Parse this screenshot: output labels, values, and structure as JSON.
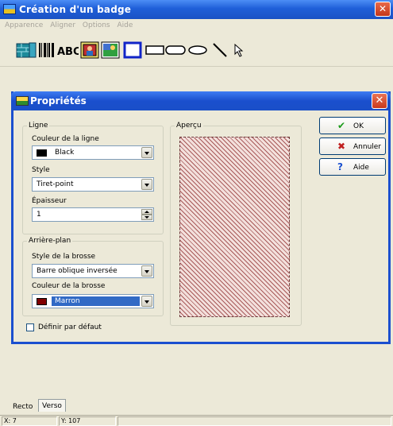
{
  "app": {
    "title": "Création d'un badge"
  },
  "menu": [
    "Apparence",
    "Aligner",
    "Options",
    "Aide"
  ],
  "toolbar_icons": [
    "wall-icon",
    "barcode-icon",
    "text-abc-icon",
    "image-icon",
    "photo-icon",
    "rectangle-icon",
    "rounded-rectangle-icon",
    "oval-rounded-icon",
    "ellipse-icon",
    "line-icon",
    "pointer-icon"
  ],
  "toolbar_labels": {
    "barcode": "ABC"
  },
  "dialog": {
    "title": "Propriétés",
    "ligne": {
      "legend": "Ligne",
      "couleur_label": "Couleur de la ligne",
      "couleur_value": "Black",
      "couleur_swatch": "#000000",
      "style_label": "Style",
      "style_value": "Tiret-point",
      "epaisseur_label": "Épaisseur",
      "epaisseur_value": "1"
    },
    "arriere_plan": {
      "legend": "Arrière-plan",
      "style_label": "Style de la brosse",
      "style_value": "Barre oblique inversée",
      "couleur_label": "Couleur de la brosse",
      "couleur_value": "Marron",
      "couleur_swatch": "#800000"
    },
    "apercu": {
      "legend": "Aperçu"
    },
    "checkbox_label": "Définir par défaut",
    "buttons": {
      "ok": "OK",
      "annuler": "Annuler",
      "aide": "Aide"
    }
  },
  "tabs": [
    "Recto",
    "Verso"
  ],
  "status": {
    "x": "X: 7",
    "y": "Y: 107"
  },
  "colors": {
    "titlebar": "#1f5fd8",
    "dialog_border": "#1b4fcf",
    "window_bg": "#ece9d8",
    "selection": "#316ac5"
  }
}
